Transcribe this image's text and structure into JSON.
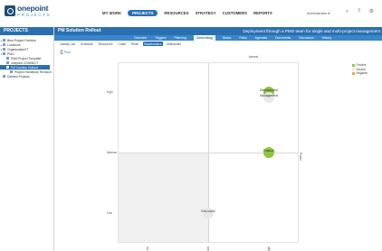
{
  "brand": {
    "name": "onepoint",
    "sub": "PROJECTS"
  },
  "main_nav": [
    {
      "label": "MY WORK",
      "active": false
    },
    {
      "label": "PROJECTS",
      "active": true
    },
    {
      "label": "RESOURCES",
      "active": false
    },
    {
      "label": "STRATEGY",
      "active": false
    },
    {
      "label": "CUSTOMERS",
      "active": false
    },
    {
      "label": "REPORTS",
      "active": false
    }
  ],
  "user_menu": "Administrator ▾",
  "icons": {
    "search": "search-icon",
    "help": "help-icon",
    "tools": "tools-icon"
  },
  "sidebar": {
    "title": "PROJECTS",
    "items": [
      {
        "label": "Best Project Portfolio",
        "mark": "▸",
        "level": 0,
        "selected": false
      },
      {
        "label": "Locations",
        "mark": "▸",
        "level": 0,
        "selected": false
      },
      {
        "label": "Organization/IT",
        "mark": "▸",
        "level": 0,
        "selected": false
      },
      {
        "label": "PMO",
        "mark": "▾",
        "level": 0,
        "selected": false
      },
      {
        "label": "PMA Project Template",
        "mark": "",
        "level": 1,
        "selected": false
      },
      {
        "label": "onepoint CONNECT",
        "mark": "",
        "level": 1,
        "selected": false
      },
      {
        "label": "PM Solution Rollout",
        "mark": "",
        "level": 1,
        "selected": true
      },
      {
        "label": "Project Handbook Revision",
        "mark": "",
        "level": 2,
        "selected": false
      },
      {
        "label": "Deleted Projects",
        "mark": "",
        "level": 0,
        "selected": false
      }
    ]
  },
  "content": {
    "title": "PM Solution Rollout",
    "description": "Deployment through a PMO team for single and multi-project management",
    "module_tabs": [
      {
        "label": "Overview",
        "active": false
      },
      {
        "label": "Triggers",
        "active": false
      },
      {
        "label": "Planning",
        "active": false
      },
      {
        "label": "Controlling",
        "active": true
      },
      {
        "label": "Status",
        "active": false
      },
      {
        "label": "Risks",
        "active": false
      },
      {
        "label": "Agendas",
        "active": false
      },
      {
        "label": "Documents",
        "active": false
      },
      {
        "label": "Discussion",
        "active": false
      },
      {
        "label": "History",
        "active": false
      }
    ],
    "sub_tabs": [
      {
        "label": "Activity List",
        "active": false
      },
      {
        "label": "Schedule",
        "active": false
      },
      {
        "label": "Resources",
        "active": false
      },
      {
        "label": "Costs",
        "active": false
      },
      {
        "label": "Risks",
        "active": false
      },
      {
        "label": "Stakeholders",
        "active": true
      },
      {
        "label": "Milestones",
        "active": false
      }
    ],
    "print_label": "Print"
  },
  "matrix": {
    "x_axis": "Interest",
    "y_axis": "Power",
    "y_levels": [
      "High",
      "Medium",
      "Low"
    ],
    "x_levels": [
      "Low",
      "Medium",
      "High"
    ],
    "stakeholders": [
      {
        "label": "Development",
        "x": "High",
        "y": "High",
        "sentiment": "Positive"
      },
      {
        "label": "Management",
        "x": "High",
        "y": "High",
        "sentiment": "Neutral"
      },
      {
        "label": "Finance",
        "x": "High",
        "y": "Medium",
        "sentiment": "Positive"
      },
      {
        "label": "End users",
        "x": "Medium",
        "y": "Low",
        "sentiment": "Neutral"
      }
    ]
  },
  "legend": [
    {
      "label": "Positive",
      "color": "#8cc63e"
    },
    {
      "label": "Neutral",
      "color": "#e8e8e8"
    },
    {
      "label": "Negative",
      "color": "#f2a32c"
    }
  ]
}
